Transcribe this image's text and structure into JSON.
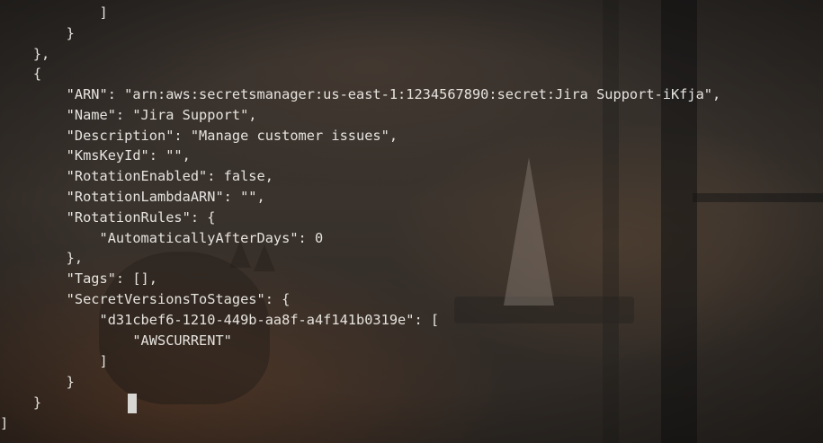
{
  "terminal": {
    "lines": [
      "            ]",
      "        }",
      "    },",
      "    {",
      "        \"ARN\": \"arn:aws:secretsmanager:us-east-1:1234567890:secret:Jira Support-iKfja\",",
      "        \"Name\": \"Jira Support\",",
      "        \"Description\": \"Manage customer issues\",",
      "        \"KmsKeyId\": \"\",",
      "        \"RotationEnabled\": false,",
      "        \"RotationLambdaARN\": \"\",",
      "        \"RotationRules\": {",
      "            \"AutomaticallyAfterDays\": 0",
      "        },",
      "        \"Tags\": [],",
      "        \"SecretVersionsToStages\": {",
      "            \"d31cbef6-1210-449b-aa8f-a4f141b0319e\": [",
      "                \"AWSCURRENT\"",
      "            ]",
      "        }",
      "    }",
      "]"
    ]
  }
}
